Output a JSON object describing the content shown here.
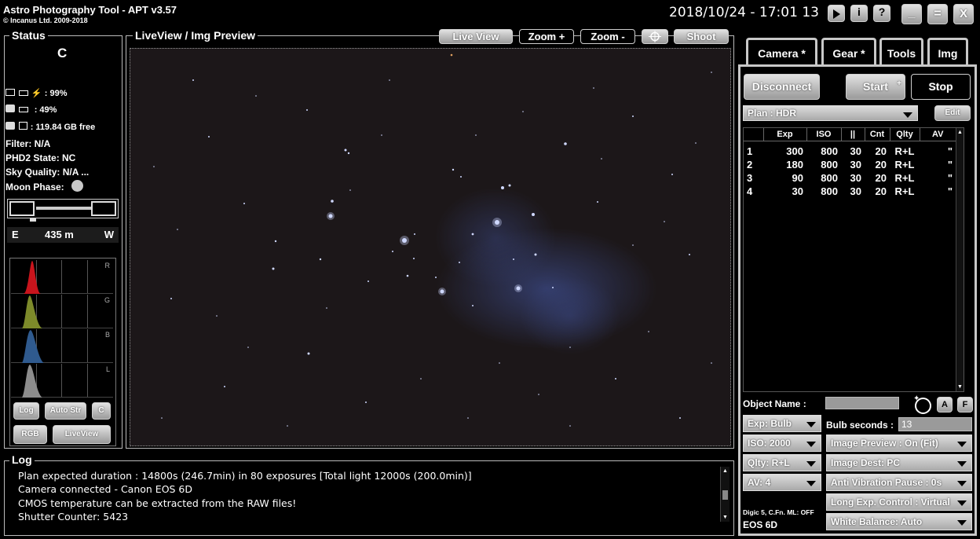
{
  "app": {
    "title": "Astro Photography Tool  -  APT v3.57",
    "copyright": "© Incanus Ltd. 2009-2018",
    "datetime": "2018/10/24 - 17:01 13"
  },
  "window_buttons": {
    "minimize": "_",
    "maximize": "=",
    "close": "X"
  },
  "status": {
    "title": "Status",
    "letter": "C",
    "battery": ": 99%",
    "camera_battery": ": 49%",
    "storage": ": 119.84 GB free",
    "filter": "Filter: N/A",
    "phd2": "PHD2 State: NC",
    "sky_quality": "Sky Quality: N/A ...",
    "moon_phase": "Moon Phase:",
    "compass_e": "E",
    "compass_value": "435 m",
    "compass_w": "W"
  },
  "histogram": {
    "labels": [
      "R",
      "G",
      "B",
      "L"
    ],
    "colors": [
      "#c8141c",
      "#7d8a2a",
      "#2f5a8e",
      "#8c8c8c"
    ],
    "buttons": {
      "log": "Log",
      "auto_str": "Auto Str",
      "c": "C",
      "rgb": "RGB",
      "liveview": "LiveView"
    }
  },
  "preview": {
    "title": "LiveView / Img Preview",
    "live_view": "Live View",
    "zoom_in": "Zoom +",
    "zoom_out": "Zoom -",
    "shoot": "Shoot"
  },
  "log": {
    "title": "Log",
    "lines": [
      "Plan expected duration : 14800s (246.7min) in 80 exposures [Total light 12000s (200.0min)]",
      "Camera connected - Canon EOS 6D",
      "CMOS temperature can be extracted from the RAW files!",
      "Shutter Counter: 5423"
    ]
  },
  "tabs": {
    "camera": "Camera *",
    "gear": "Gear *",
    "tools": "Tools",
    "img": "Img"
  },
  "camera": {
    "disconnect": "Disconnect",
    "start": "Start",
    "stop": "Stop",
    "plan": "Plan : HDR",
    "edit": "Edit",
    "columns": [
      "",
      "Exp",
      "ISO",
      "||",
      "Cnt",
      "Qlty",
      "AV"
    ],
    "rows": [
      [
        "1",
        "300",
        "800",
        "30",
        "20",
        "R+L",
        "\""
      ],
      [
        "2",
        "180",
        "800",
        "30",
        "20",
        "R+L",
        "\""
      ],
      [
        "3",
        "90",
        "800",
        "30",
        "20",
        "R+L",
        "\""
      ],
      [
        "4",
        "30",
        "800",
        "30",
        "20",
        "R+L",
        "\""
      ]
    ],
    "object_name_label": "Object Name :",
    "object_name_value": "",
    "a_btn": "A",
    "f_btn": "F",
    "exp": "Exp: Bulb",
    "bulb_label": "Bulb seconds :",
    "bulb_value": "13",
    "iso": "ISO: 2000",
    "image_preview": "Image Preview : On (Fit)",
    "qlty": "Qlty: R+L",
    "image_dest": "Image Dest: PC",
    "av": "AV: 4",
    "anti_vibration": "Anti Vibration Pause : 0s",
    "long_exp": "Long Exp. Control : Virtual",
    "white_balance": "White Balance: Auto",
    "digic": "Digic 5, C.Fn. ML: OFF",
    "model": "EOS 6D"
  }
}
